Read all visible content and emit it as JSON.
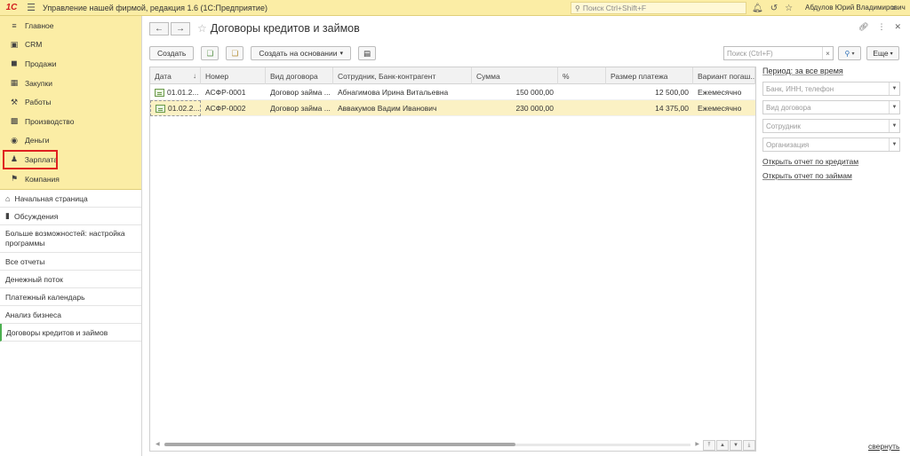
{
  "topbar": {
    "logo": "1С",
    "app_title": "Управление нашей фирмой, редакция 1.6  (1С:Предприятие)",
    "search_placeholder": "Поиск Ctrl+Shift+F",
    "user_name": "Абдулов Юрий Владимирович"
  },
  "sidebar": {
    "sections": [
      {
        "label": "Главное",
        "icon": "menu-lines-icon"
      },
      {
        "label": "CRM",
        "icon": "briefcase-icon"
      },
      {
        "label": "Продажи",
        "icon": "cart-icon"
      },
      {
        "label": "Закупки",
        "icon": "warehouse-icon"
      },
      {
        "label": "Работы",
        "icon": "hammer-icon"
      },
      {
        "label": "Производство",
        "icon": "factory-icon"
      },
      {
        "label": "Деньги",
        "icon": "coin-icon"
      },
      {
        "label": "Зарплата",
        "icon": "people-icon"
      },
      {
        "label": "Компания",
        "icon": "flag-icon"
      }
    ],
    "nav": [
      {
        "label": "Начальная страница",
        "icon": "home-icon"
      },
      {
        "label": "Обсуждения",
        "icon": "chat-icon"
      },
      {
        "label": "Больше возможностей: настройка программы"
      },
      {
        "label": "Все отчеты"
      },
      {
        "label": "Денежный поток"
      },
      {
        "label": "Платежный календарь"
      },
      {
        "label": "Анализ бизнеса"
      },
      {
        "label": "Договоры кредитов и займов"
      }
    ]
  },
  "main": {
    "title": "Договоры кредитов и займов",
    "toolbar": {
      "create_label": "Создать",
      "create_based_label": "Создать на основании",
      "more_label": "Еще"
    },
    "list_search_placeholder": "Поиск (Ctrl+F)",
    "columns": [
      "Дата",
      "Номер",
      "Вид договора",
      "Сотрудник, Банк-контрагент",
      "Сумма",
      "%",
      "Размер платежа",
      "Вариант погаш..."
    ],
    "rows": [
      {
        "date": "01.01.2...",
        "number": "АСФР-0001",
        "kind": "Договор займа ...",
        "counterparty": "Абнагимова Ирина Витальевна",
        "amount": "150 000,00",
        "percent": "",
        "payment": "12 500,00",
        "variant": "Ежемесячно"
      },
      {
        "date": "01.02.2...",
        "number": "АСФР-0002",
        "kind": "Договор займа ...",
        "counterparty": "Аввакумов Вадим Иванович",
        "amount": "230 000,00",
        "percent": "",
        "payment": "14 375,00",
        "variant": "Ежемесячно"
      }
    ]
  },
  "filters": {
    "period_label": "Период:",
    "period_value": "за все время",
    "bank_placeholder": "Банк, ИНН, телефон",
    "kind_placeholder": "Вид договора",
    "employee_placeholder": "Сотрудник",
    "org_placeholder": "Организация",
    "link_credits": "Открыть отчет по кредитам",
    "link_loans": "Открыть отчет по займам"
  },
  "collapse_label": "свернуть"
}
